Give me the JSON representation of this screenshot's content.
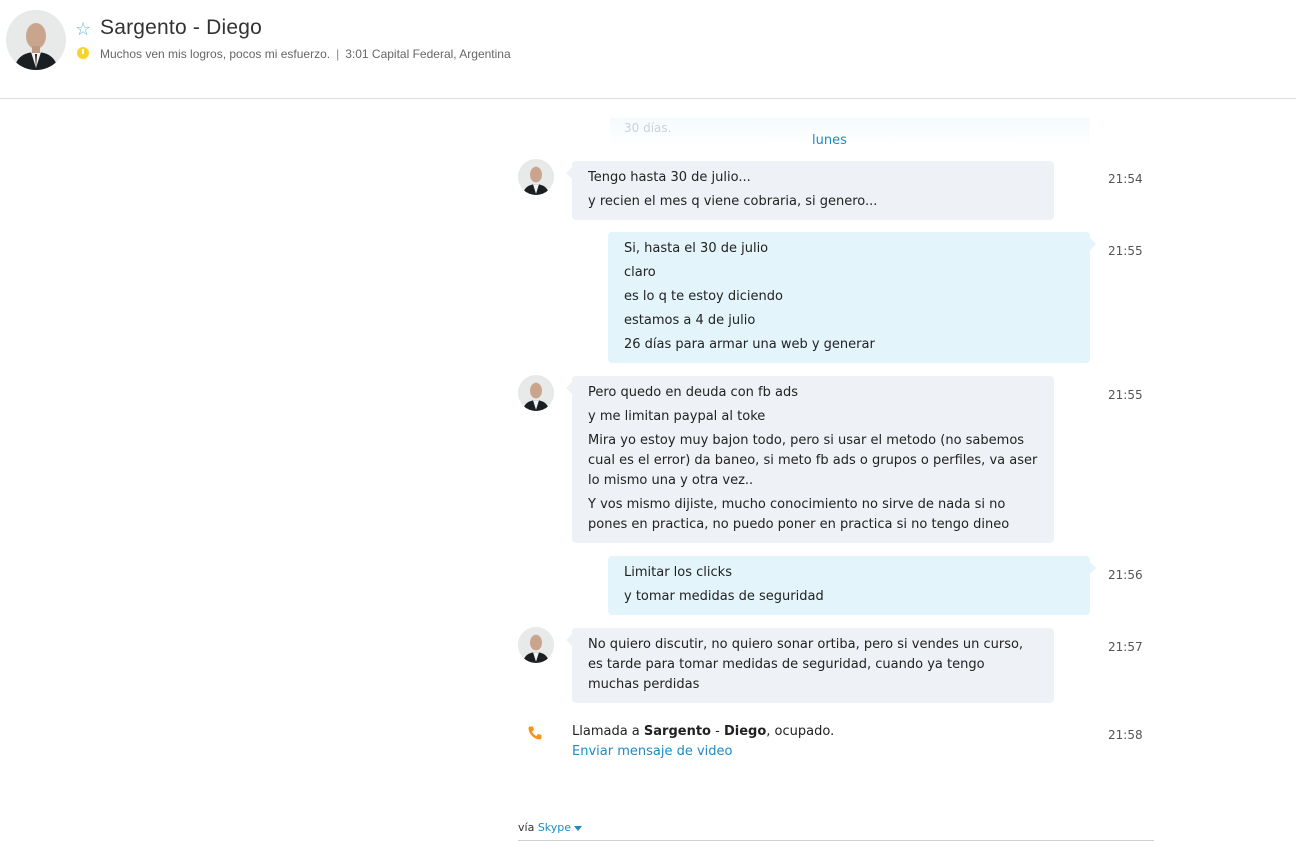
{
  "header": {
    "name": "Sargento - Diego",
    "mood": "Muchos ven mis logros, pocos mi esfuerzo.",
    "separator": "|",
    "local_info": "3:01 Capital Federal, Argentina"
  },
  "faded_text": "30 días.",
  "day_label": "lunes",
  "messages": [
    {
      "time": "21:54",
      "lines": [
        "Tengo hasta 30 de julio...",
        "y recien el mes q viene cobraria, si genero..."
      ]
    },
    {
      "time": "21:55",
      "lines": [
        "Si, hasta el 30 de julio",
        "claro",
        "es lo q te estoy diciendo",
        "estamos a 4 de julio",
        "26 días para armar una web y generar"
      ]
    },
    {
      "time": "21:55",
      "lines": [
        "Pero quedo en deuda con fb ads",
        "y me limitan paypal al toke",
        "Mira yo estoy muy bajon todo, pero si usar el metodo (no sabemos cual es el error) da baneo, si meto fb ads o grupos o perfiles, va aser lo mismo una y otra vez..",
        "Y vos mismo dijiste, mucho conocimiento no sirve de nada si no pones en practica, no puedo poner en practica si no tengo dineo"
      ]
    },
    {
      "time": "21:56",
      "lines": [
        "Limitar los clicks",
        "y tomar medidas de seguridad"
      ]
    },
    {
      "time": "21:57",
      "lines": [
        "No quiero discutir, no quiero sonar ortiba, pero si vendes un curso, es tarde para tomar medidas de seguridad, cuando ya tengo muchas perdidas"
      ]
    }
  ],
  "call": {
    "time": "21:58",
    "prefix": "Llamada a ",
    "first": "Sargento",
    "dash": " - ",
    "last": "Diego",
    "suffix": ", ocupado.",
    "video_link": "Enviar mensaje de video"
  },
  "footer": {
    "via": "vía",
    "service": "Skype"
  },
  "colors": {
    "accent": "#1e8bc3",
    "incoming": "#eef1f5",
    "outgoing": "#e3f4fb",
    "status_away": "#f8d42a",
    "call_icon": "#f7941d"
  }
}
